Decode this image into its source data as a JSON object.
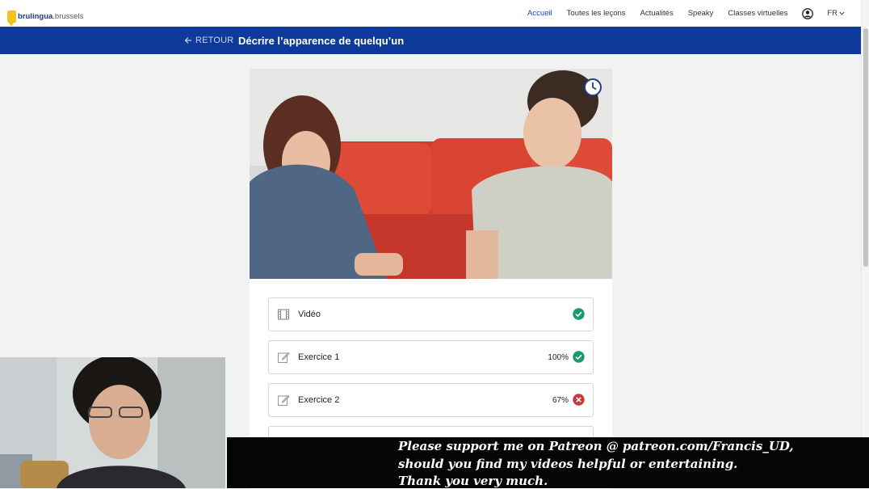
{
  "logo": {
    "name": "brulingua",
    "suffix": ".brussels"
  },
  "nav": {
    "links": [
      {
        "label": "Accueil",
        "active": true
      },
      {
        "label": "Toutes les leçons",
        "active": false
      },
      {
        "label": "Actualités",
        "active": false
      },
      {
        "label": "Speaky",
        "active": false
      },
      {
        "label": "Classes virtuelles",
        "active": false
      }
    ],
    "user_icon": "user-circle-icon",
    "language": "FR"
  },
  "titlebar": {
    "back_label": "RETOUR",
    "title": "Décrire l’apparence de quelqu’un"
  },
  "lesson": {
    "photo_icon": "clock-icon",
    "items": [
      {
        "icon": "film-icon",
        "label": "Vidéo",
        "score": "",
        "status": "complete"
      },
      {
        "icon": "edit-icon",
        "label": "Exercice 1",
        "score": "100%",
        "status": "complete"
      },
      {
        "icon": "edit-icon",
        "label": "Exercice 2",
        "score": "67%",
        "status": "failed"
      }
    ]
  },
  "subtitles": {
    "line1": "Please support me on Patreon @ patreon.com/Francis_UD,",
    "line2": "should you find my videos helpful or entertaining.",
    "line3": "Thank you very much."
  },
  "colors": {
    "brand_blue": "#0d3a9b",
    "link_active": "#1a4bb5",
    "success": "#1a9a6c",
    "error": "#c63a3a",
    "logo_yellow": "#f4c21a"
  }
}
